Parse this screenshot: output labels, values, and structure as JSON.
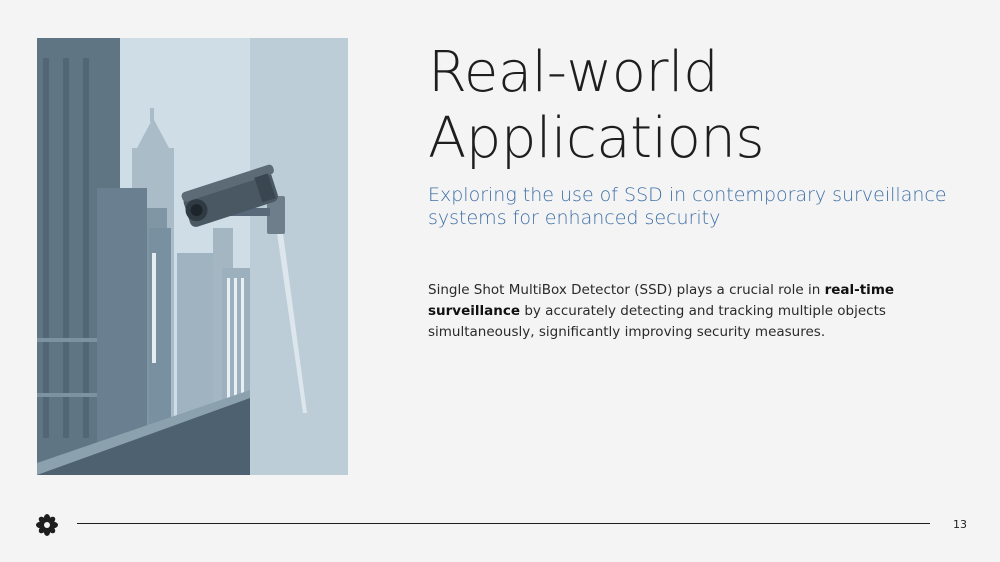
{
  "slide": {
    "title_line1": "Real-world",
    "title_line2": "Applications",
    "subtitle": "Exploring the use of SSD in contemporary surveillance systems for enhanced security",
    "body": {
      "intro": "Single Shot MultiBox Detector (SSD) plays a crucial role in ",
      "bold1": "real-time",
      "bold2": "surveillance",
      "rest": " by accurately detecting and tracking multiple objects simultaneously, significantly improving security measures."
    },
    "page_number": "13"
  },
  "image": {
    "subject": "security camera mounted on wall overlooking city skyline",
    "palette": {
      "sky": "#cfdde6",
      "wall": "#bccdd8",
      "buildings_dark": "#5d7282",
      "buildings_mid": "#8aa0ae",
      "buildings_far": "#a9bcc8",
      "camera": "#4a5863"
    }
  },
  "footer": {
    "logo_icon": "asterisk-flower-icon",
    "rule_color": "#1e1e1e"
  }
}
